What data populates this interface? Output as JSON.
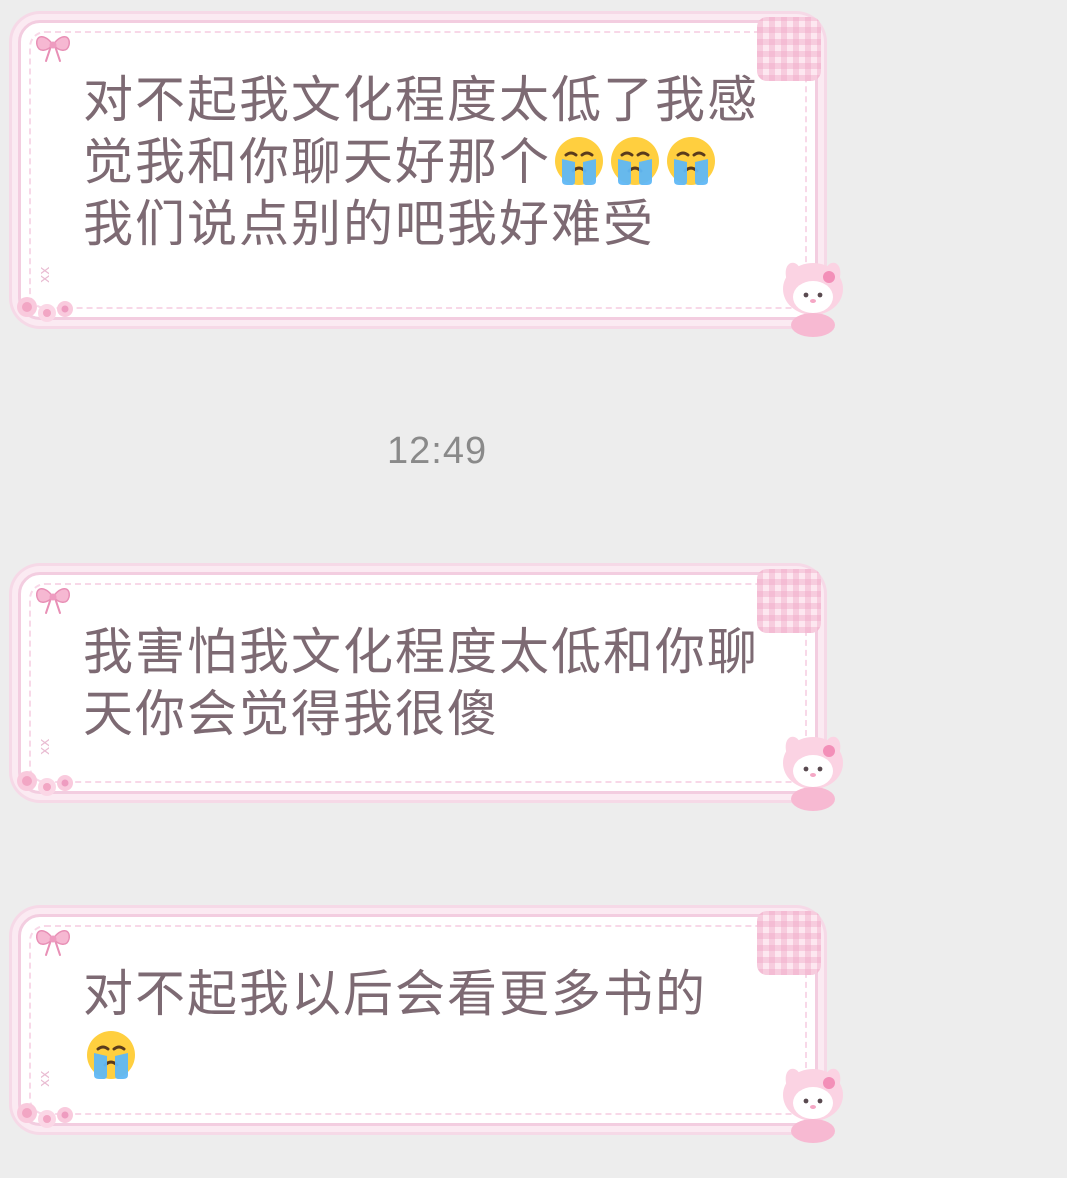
{
  "messages": [
    {
      "segments": [
        {
          "type": "text",
          "value": "对不起我文化程度太低了我感觉我和你聊天好那个"
        },
        {
          "type": "emoji",
          "icon": "crying-face-icon"
        },
        {
          "type": "emoji",
          "icon": "crying-face-icon"
        },
        {
          "type": "emoji",
          "icon": "crying-face-icon"
        },
        {
          "type": "text",
          "value": "我们说点别的吧我好难受"
        }
      ]
    },
    {
      "segments": [
        {
          "type": "text",
          "value": "我害怕我文化程度太低和你聊天你会觉得我很傻"
        }
      ]
    },
    {
      "segments": [
        {
          "type": "text",
          "value": "对不起我以后会看更多书的"
        },
        {
          "type": "emoji",
          "icon": "crying-face-icon"
        }
      ]
    }
  ],
  "timestamp": "12:49",
  "decorations": {
    "bubble_corner_mark": "xx"
  },
  "colors": {
    "background": "#ededed",
    "bubble_fill": "#ffffff",
    "bubble_border": "#f3cde0",
    "message_text": "#7d6a73",
    "timestamp_text": "#8a8a8a",
    "accent_pink": "#f2a6c4"
  }
}
